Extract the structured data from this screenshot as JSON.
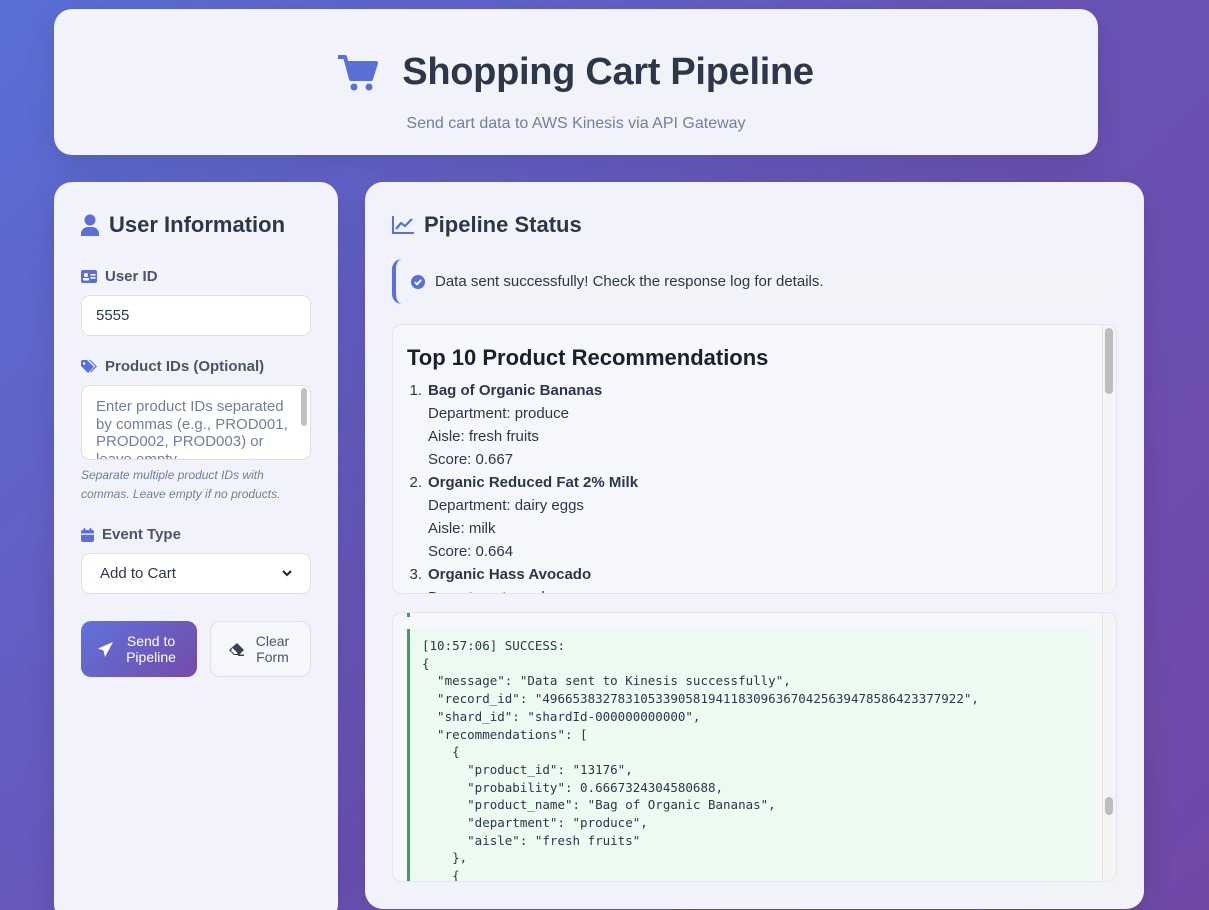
{
  "header": {
    "title": "Shopping Cart Pipeline",
    "subtitle": "Send cart data to AWS Kinesis via API Gateway"
  },
  "user_panel": {
    "title": "User Information",
    "user_id_label": "User ID",
    "user_id_value": "5555",
    "product_ids_label": "Product IDs (Optional)",
    "product_ids_placeholder": "Enter product IDs separated by commas (e.g., PROD001, PROD002, PROD003) or leave empty",
    "product_ids_hint": "Separate multiple product IDs with commas. Leave empty if no products.",
    "event_type_label": "Event Type",
    "event_type_value": "Add to Cart",
    "send_button": "Send to Pipeline",
    "clear_button": "Clear Form"
  },
  "status_panel": {
    "title": "Pipeline Status",
    "alert_text": "Data sent successfully! Check the response log for details.",
    "recommendations_title": "Top 10 Product Recommendations",
    "recommendations": [
      {
        "num": "1.",
        "name": "Bag of Organic Bananas",
        "department": "Department: produce",
        "aisle": "Aisle: fresh fruits",
        "score": "Score: 0.667"
      },
      {
        "num": "2.",
        "name": "Organic Reduced Fat 2% Milk",
        "department": "Department: dairy eggs",
        "aisle": "Aisle: milk",
        "score": "Score: 0.664"
      },
      {
        "num": "3.",
        "name": "Organic Hass Avocado",
        "department": "Department: produce",
        "aisle": "",
        "score": ""
      }
    ],
    "log_text": "[10:57:06] SUCCESS:\n{\n  \"message\": \"Data sent to Kinesis successfully\",\n  \"record_id\": \"49665383278310533905819411830963670425639478586423377922\",\n  \"shard_id\": \"shardId-000000000000\",\n  \"recommendations\": [\n    {\n      \"product_id\": \"13176\",\n      \"probability\": 0.6667324304580688,\n      \"product_name\": \"Bag of Organic Bananas\",\n      \"department\": \"produce\",\n      \"aisle\": \"fresh fruits\"\n    },\n    {"
  },
  "colors": {
    "accent": "#5a6fd8",
    "success": "#38a169"
  },
  "icons": {
    "header": "shopping-cart-icon",
    "user": "user-icon",
    "id": "id-card-icon",
    "tags": "tags-icon",
    "calendar": "calendar-icon",
    "send": "paper-plane-icon",
    "clear": "eraser-icon",
    "status": "chart-line-icon",
    "check": "check-circle-icon"
  }
}
